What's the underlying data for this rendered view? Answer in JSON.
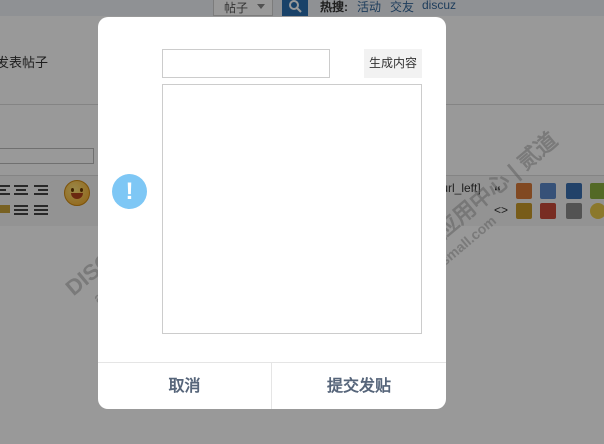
{
  "header": {
    "category_select": "帖子",
    "hot_label": "热搜:",
    "hot_links": [
      "活动",
      "交友",
      "discuz"
    ]
  },
  "editor": {
    "post_title": "发表帖子",
    "toolbar_code_label": "[url_left]"
  },
  "watermark": {
    "line1": "DISCUZ!应用中心 | 贰道",
    "line2": "addon.dismall.com"
  },
  "modal": {
    "title_input_value": "",
    "generate_button": "生成内容",
    "content_value": "",
    "cancel_button": "取消",
    "submit_button": "提交发贴",
    "alert_symbol": "!"
  },
  "colors": {
    "overlay": "rgba(0,0,0,0.4)",
    "alert_icon": "#7ec7f5",
    "footer_text": "#56657a",
    "search_button": "#2b6fb0"
  }
}
